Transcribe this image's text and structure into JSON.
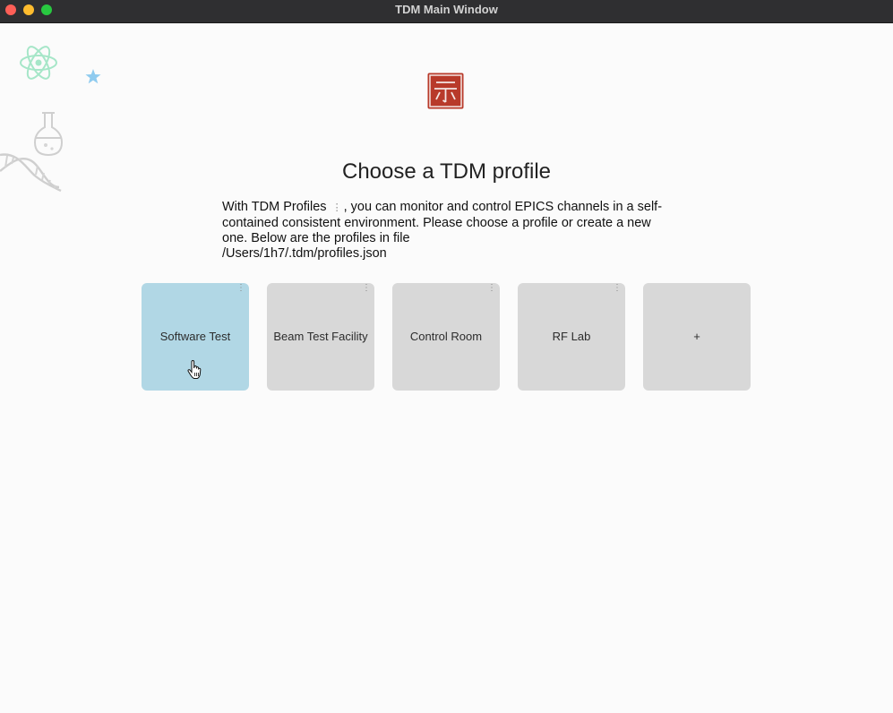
{
  "window": {
    "title": "TDM Main Window"
  },
  "header": {
    "title": "Choose a TDM profile",
    "description_prefix": "With TDM Profiles",
    "description_suffix": ", you can monitor and control EPICS channels in a self-contained consistent environment. Please choose a profile or create a new one. Below are the profiles in file",
    "profiles_path": "/Users/1h7/.tdm/profiles.json"
  },
  "profiles": [
    {
      "label": "Software Test",
      "selected": true
    },
    {
      "label": "Beam Test Facility",
      "selected": false
    },
    {
      "label": "Control Room",
      "selected": false
    },
    {
      "label": "RF Lab",
      "selected": false
    }
  ],
  "add_profile": {
    "label": "+"
  },
  "icons": {
    "logo": "tdm-logo-icon",
    "menu": "kebab-menu-icon",
    "atom": "atom-icon",
    "star": "star-icon",
    "flask": "flask-icon",
    "dna": "dna-icon",
    "cursor": "hand-cursor-icon"
  },
  "colors": {
    "logo_red": "#b83a2a",
    "card_selected": "#b1d7e5",
    "card_default": "#d8d8d8"
  }
}
